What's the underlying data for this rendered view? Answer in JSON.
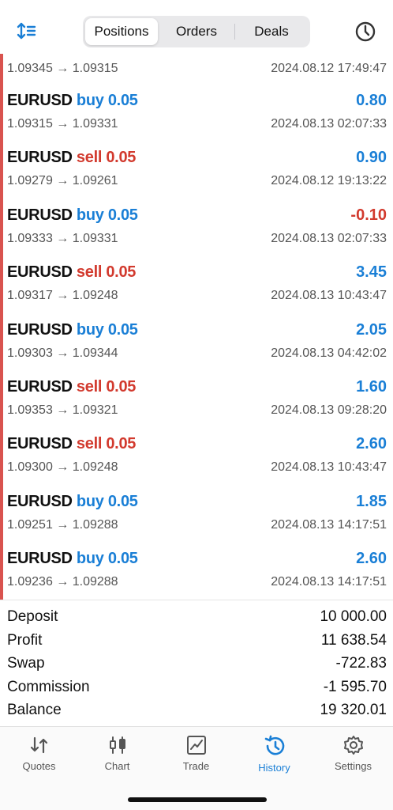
{
  "header": {
    "tabs": [
      "Positions",
      "Orders",
      "Deals"
    ],
    "active_tab": "Positions"
  },
  "top_row": {
    "prices": "1.09345 → 1.09315",
    "time": "2024.08.12 17:49:47"
  },
  "deals": [
    {
      "symbol": "EURUSD",
      "side": "buy",
      "volume": "0.05",
      "profit": "0.80",
      "prices": "1.09315 → 1.09331",
      "time": "2024.08.13 02:07:33"
    },
    {
      "symbol": "EURUSD",
      "side": "sell",
      "volume": "0.05",
      "profit": "0.90",
      "prices": "1.09279 → 1.09261",
      "time": "2024.08.12 19:13:22"
    },
    {
      "symbol": "EURUSD",
      "side": "buy",
      "volume": "0.05",
      "profit": "-0.10",
      "prices": "1.09333 → 1.09331",
      "time": "2024.08.13 02:07:33"
    },
    {
      "symbol": "EURUSD",
      "side": "sell",
      "volume": "0.05",
      "profit": "3.45",
      "prices": "1.09317 → 1.09248",
      "time": "2024.08.13 10:43:47"
    },
    {
      "symbol": "EURUSD",
      "side": "buy",
      "volume": "0.05",
      "profit": "2.05",
      "prices": "1.09303 → 1.09344",
      "time": "2024.08.13 04:42:02"
    },
    {
      "symbol": "EURUSD",
      "side": "sell",
      "volume": "0.05",
      "profit": "1.60",
      "prices": "1.09353 → 1.09321",
      "time": "2024.08.13 09:28:20"
    },
    {
      "symbol": "EURUSD",
      "side": "sell",
      "volume": "0.05",
      "profit": "2.60",
      "prices": "1.09300 → 1.09248",
      "time": "2024.08.13 10:43:47"
    },
    {
      "symbol": "EURUSD",
      "side": "buy",
      "volume": "0.05",
      "profit": "1.85",
      "prices": "1.09251 → 1.09288",
      "time": "2024.08.13 14:17:51"
    },
    {
      "symbol": "EURUSD",
      "side": "buy",
      "volume": "0.05",
      "profit": "2.60",
      "prices": "1.09236 → 1.09288",
      "time": "2024.08.13 14:17:51"
    }
  ],
  "summary": [
    {
      "label": "Deposit",
      "value": "10 000.00"
    },
    {
      "label": "Profit",
      "value": "11 638.54"
    },
    {
      "label": "Swap",
      "value": "-722.83"
    },
    {
      "label": "Commission",
      "value": "-1 595.70"
    },
    {
      "label": "Balance",
      "value": "19 320.01"
    }
  ],
  "tabbar": [
    {
      "label": "Quotes",
      "icon": "quotes-icon"
    },
    {
      "label": "Chart",
      "icon": "chart-icon"
    },
    {
      "label": "Trade",
      "icon": "trade-icon"
    },
    {
      "label": "History",
      "icon": "history-icon",
      "active": true
    },
    {
      "label": "Settings",
      "icon": "settings-icon"
    }
  ],
  "colors": {
    "accent_blue": "#1a7fd6",
    "sell_red": "#d23a2e",
    "side_bar_red": "#d9534f"
  }
}
